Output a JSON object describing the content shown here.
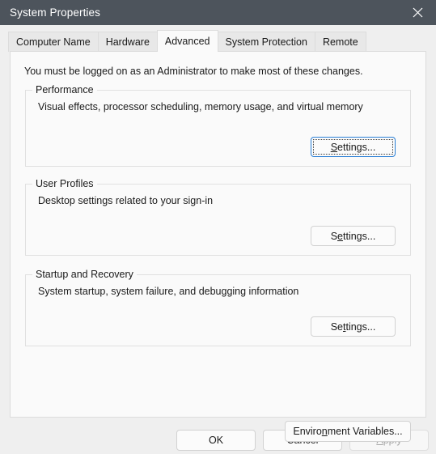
{
  "window": {
    "title": "System Properties",
    "close_icon": "close-icon",
    "titlebar_color": "#4d545c",
    "background_color": "#efefef",
    "panel_color": "#fafafa",
    "focus_accent_color": "#2a7fd4"
  },
  "tabs": [
    {
      "label": "Computer Name",
      "selected": false
    },
    {
      "label": "Hardware",
      "selected": false
    },
    {
      "label": "Advanced",
      "selected": true
    },
    {
      "label": "System Protection",
      "selected": false
    },
    {
      "label": "Remote",
      "selected": false
    }
  ],
  "main": {
    "intro": "You must be logged on as an Administrator to make most of these changes.",
    "groups": [
      {
        "legend": "Performance",
        "description": "Visual effects, processor scheduling, memory usage, and virtual memory",
        "button": {
          "label": "Settings...",
          "accelerator": "S",
          "prefix": "",
          "suffix": "ettings...",
          "focused": true,
          "disabled": false
        }
      },
      {
        "legend": "User Profiles",
        "description": "Desktop settings related to your sign-in",
        "button": {
          "label": "Settings...",
          "accelerator": "e",
          "prefix": "S",
          "suffix": "ttings...",
          "focused": false,
          "disabled": false
        }
      },
      {
        "legend": "Startup and Recovery",
        "description": "System startup, system failure, and debugging information",
        "button": {
          "label": "Settings...",
          "accelerator": "t",
          "prefix": "Se",
          "suffix": "tings...",
          "focused": false,
          "disabled": false
        }
      }
    ],
    "environment_button": {
      "label": "Environment Variables...",
      "accelerator": "n",
      "prefix": "Enviro",
      "suffix": "ment Variables...",
      "disabled": false
    }
  },
  "footer": {
    "ok": {
      "label": "OK",
      "disabled": false
    },
    "cancel": {
      "label": "Cancel",
      "disabled": false
    },
    "apply": {
      "label": "Apply",
      "accelerator": "A",
      "prefix": "",
      "suffix": "pply",
      "disabled": true
    }
  }
}
